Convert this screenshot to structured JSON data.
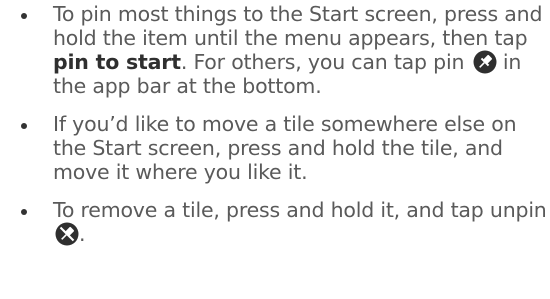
{
  "instructions": [
    {
      "text_before": "To pin most things to the Start screen, press and hold the item until the menu appears, then tap ",
      "bold_text": "pin to start",
      "text_middle": ". For others, you can tap pin",
      "icon": "pin-icon",
      "text_after": " in the app bar at the bottom."
    },
    {
      "text": "If you’d like to move a tile somewhere else on the Start screen, press and hold the tile, and move it where you like it."
    },
    {
      "text_before": "To remove a tile, press and hold it, and tap unpin",
      "icon": "unpin-icon",
      "text_after": "."
    }
  ],
  "colors": {
    "text": "#5a5a5a",
    "bullet": "#333333",
    "icon_bg": "#2f2f2f",
    "icon_fg": "#ffffff"
  }
}
